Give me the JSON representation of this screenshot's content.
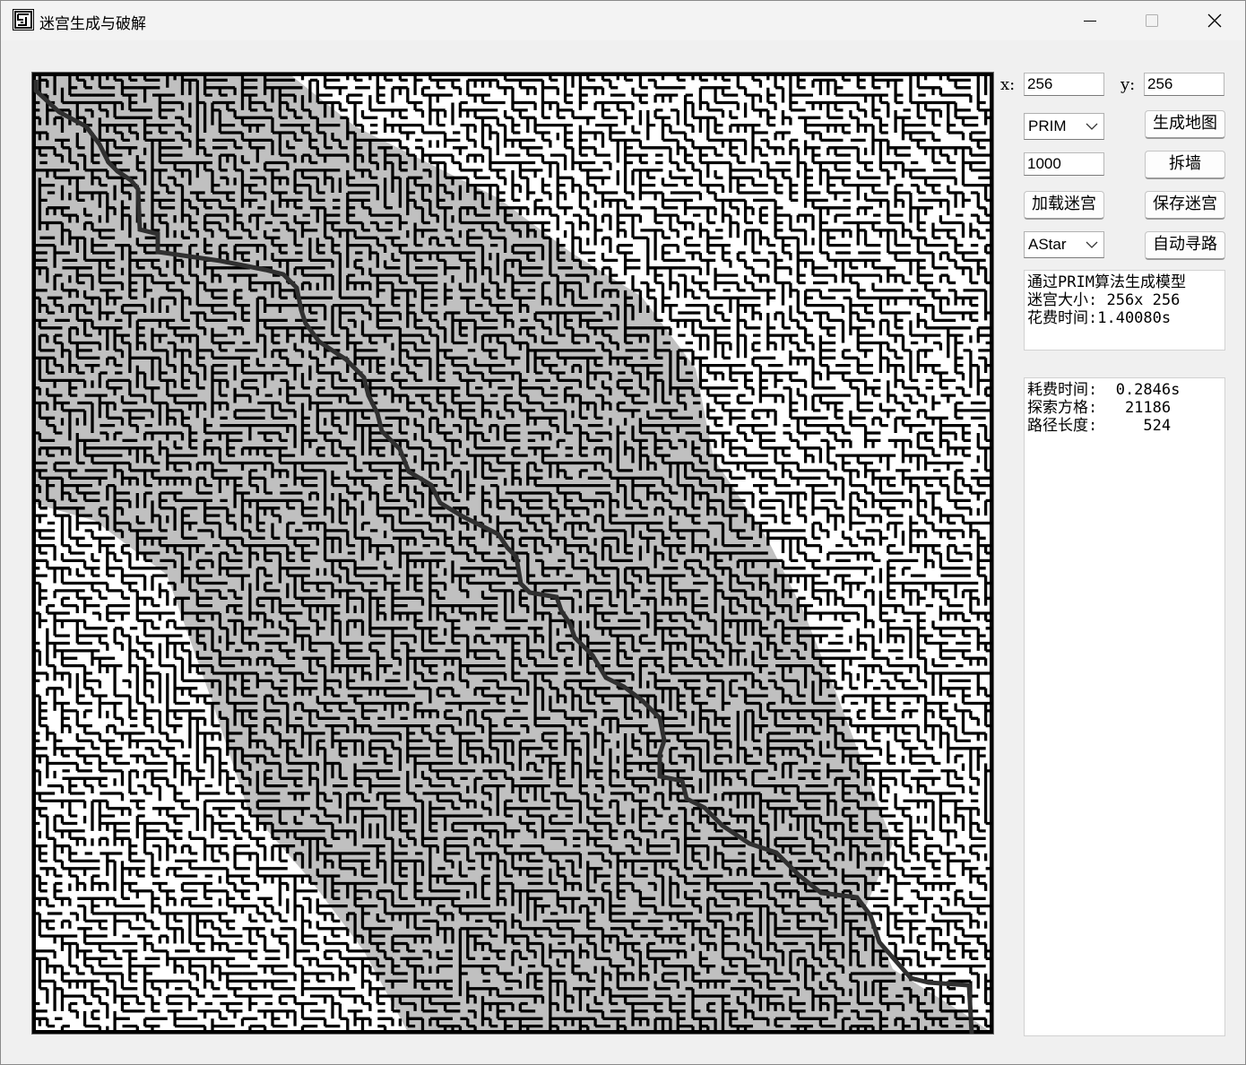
{
  "window": {
    "title": "迷宫生成与破解"
  },
  "controls": {
    "x_label": "x:",
    "x_value": "256",
    "y_label": "y:",
    "y_value": "256",
    "algorithm_select": "PRIM",
    "generate_button": "生成地图",
    "wall_count_value": "1000",
    "remove_walls_button": "拆墙",
    "load_button": "加载迷宫",
    "save_button": "保存迷宫",
    "solver_select": "AStar",
    "solve_button": "自动寻路"
  },
  "generation_info": {
    "lines": [
      "通过PRIM算法生成模型",
      "迷宫大小: 256x 256",
      "花费时间:1.40080s"
    ]
  },
  "solve_info": {
    "lines": [
      "耗费时间:  0.2846s",
      "探索方格:   21186",
      "路径长度:     524"
    ]
  },
  "maze": {
    "size": 256,
    "colors": {
      "wall": "#000000",
      "open": "#ffffff",
      "explored": "#c0c0c0",
      "path": "#303030"
    }
  }
}
